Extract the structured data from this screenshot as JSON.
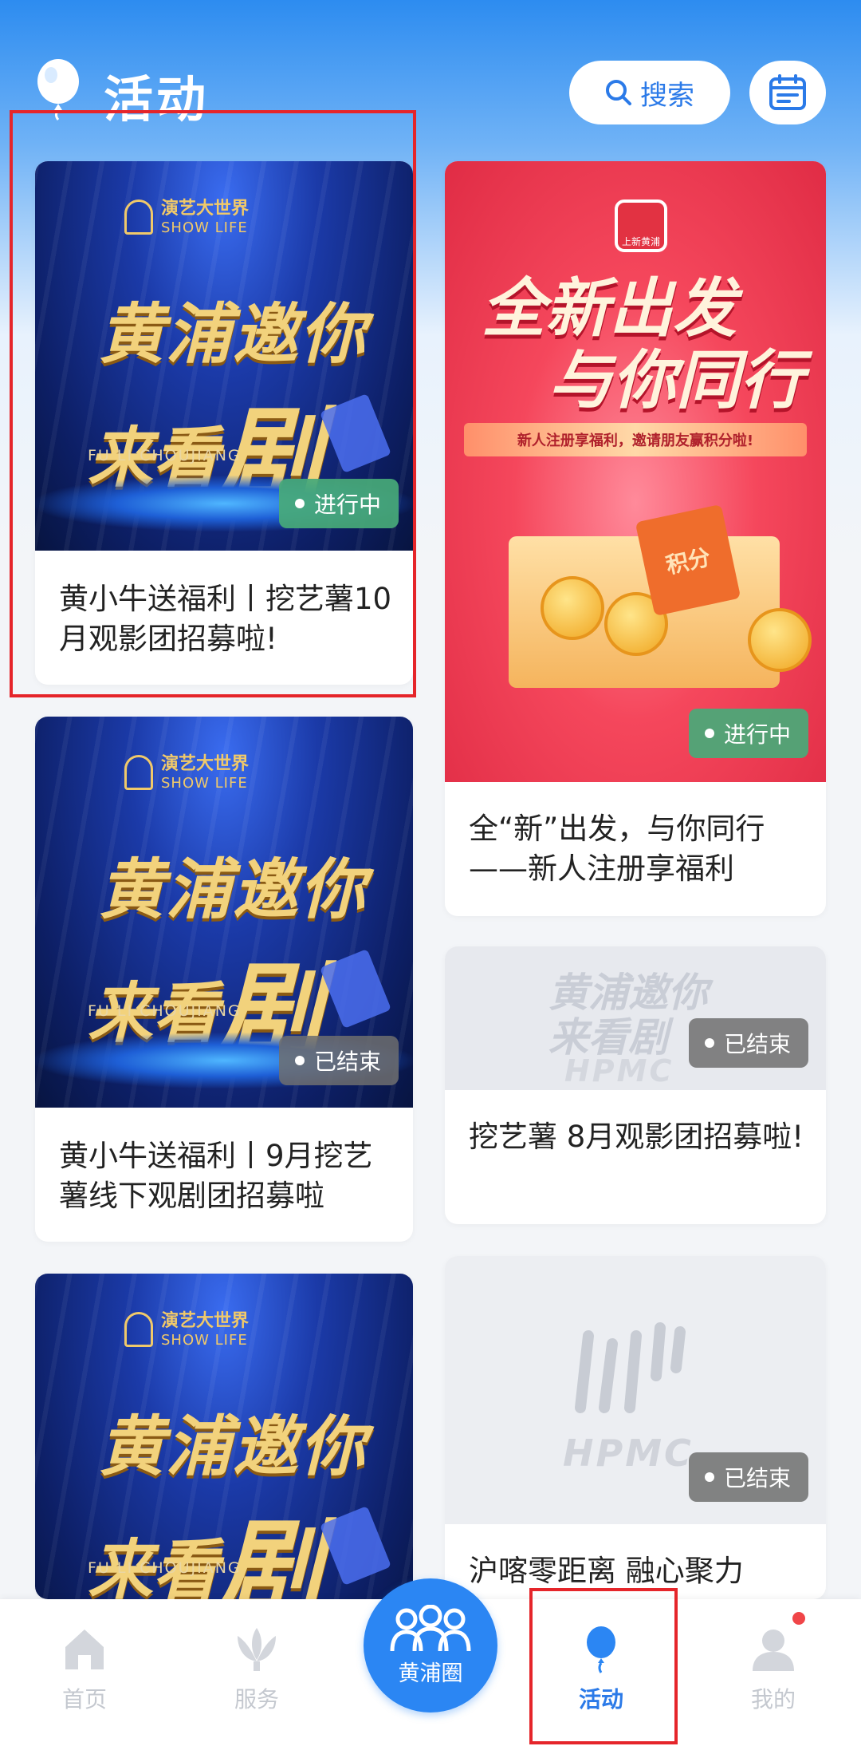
{
  "header": {
    "title": "活动",
    "search_label": "搜索"
  },
  "cards": [
    {
      "title": "黄小牛送福利丨挖艺薯10月观影团招募啦!",
      "status": "进行中",
      "poster": {
        "brand": "演艺大世界",
        "brand_en": "SHOW LIFE",
        "line1": "黄浦邀你",
        "line2_a": "来看",
        "line2_b": "剧",
        "subtitle": "FU LI CHOUJIANG"
      }
    },
    {
      "title": "全“新”出发，与你同行 ——新人注册享福利",
      "status": "进行中",
      "poster": {
        "logo_text": "上新黄浦",
        "line1": "全新出发",
        "line2": "与你同行",
        "strip": "新人注册享福利，邀请朋友赢积分啦!",
        "coupon": "积分"
      }
    },
    {
      "title": "黄小牛送福利丨9月挖艺薯线下观剧团招募啦",
      "status": "已结束",
      "poster": {
        "brand": "演艺大世界",
        "brand_en": "SHOW LIFE",
        "line1": "黄浦邀你",
        "line2_a": "来看",
        "line2_b": "剧",
        "subtitle": "FU LI CHOUJIANG"
      }
    },
    {
      "title": "挖艺薯 8月观影团招募啦!",
      "status": "已结束",
      "poster": {
        "line1": "黄浦邀你",
        "line2": "来看剧",
        "brand": "HPMC"
      }
    },
    {
      "title": "",
      "status": "",
      "poster": {
        "brand": "演艺大世界",
        "brand_en": "SHOW LIFE",
        "line1": "黄浦邀你",
        "line2_a": "来看",
        "line2_b": "剧",
        "subtitle": "FU LI CHOUJIANG"
      }
    },
    {
      "title": "沪喀零距离 融心聚力",
      "status": "已结束",
      "poster": {
        "brand": "HPMC"
      }
    }
  ],
  "bottom_nav": {
    "items": [
      {
        "label": "首页",
        "icon": "home-icon"
      },
      {
        "label": "服务",
        "icon": "lotus-icon"
      },
      {
        "label": "黄浦圈",
        "icon": "group-icon"
      },
      {
        "label": "活动",
        "icon": "balloon-icon"
      },
      {
        "label": "我的",
        "icon": "user-icon"
      }
    ],
    "active": "活动"
  },
  "colors": {
    "accent": "#2b7ae8",
    "active_badge": "#48aa78",
    "ended_badge": "#6e6e6e",
    "highlight": "#e5252a"
  }
}
